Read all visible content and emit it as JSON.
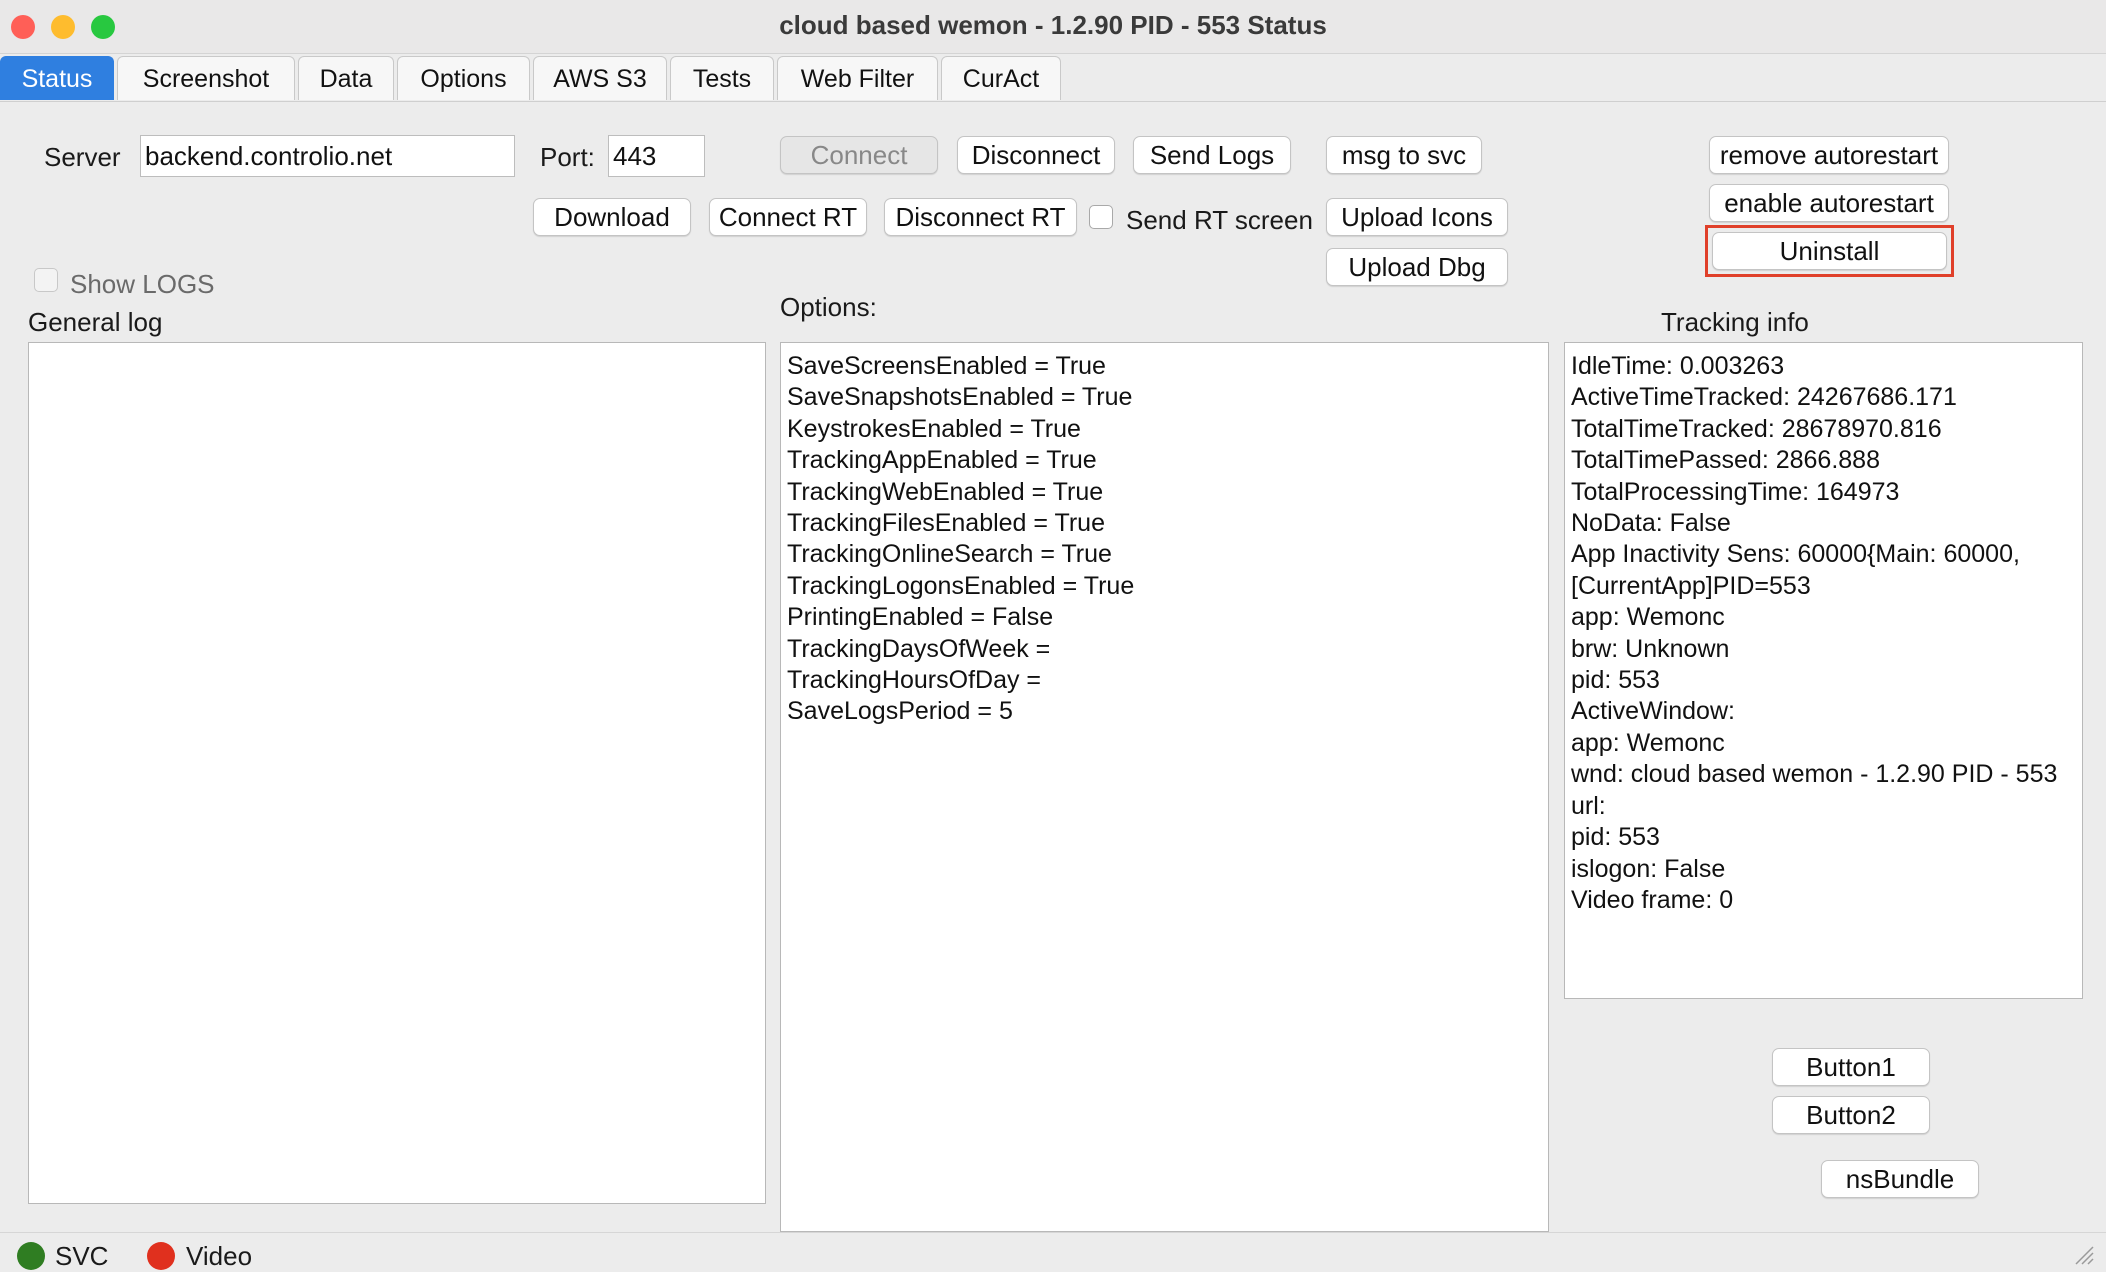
{
  "window": {
    "title": "cloud based wemon - 1.2.90 PID - 553 Status",
    "traffic_lights": [
      "#ff5f57",
      "#febc2e",
      "#28c840"
    ]
  },
  "tabs": [
    {
      "label": "Status",
      "active": true
    },
    {
      "label": "Screenshot"
    },
    {
      "label": "Data"
    },
    {
      "label": "Options"
    },
    {
      "label": "AWS S3"
    },
    {
      "label": "Tests"
    },
    {
      "label": "Web Filter"
    },
    {
      "label": "CurAct"
    }
  ],
  "connection": {
    "server_label": "Server",
    "server_value": "backend.controlio.net",
    "port_label": "Port:",
    "port_value": "443"
  },
  "buttons": {
    "connect": "Connect",
    "disconnect": "Disconnect",
    "send_logs": "Send Logs",
    "msg_to_svc": "msg to svc",
    "remove_autorestart": "remove autorestart",
    "enable_autorestart": "enable autorestart",
    "uninstall": "Uninstall",
    "download": "Download",
    "connect_rt": "Connect RT",
    "disconnect_rt": "Disconnect RT",
    "upload_icons": "Upload Icons",
    "upload_dbg": "Upload Dbg",
    "button1": "Button1",
    "button2": "Button2",
    "nsbundle": "nsBundle"
  },
  "checkboxes": {
    "send_rt_screen": {
      "label": "Send RT screen",
      "checked": false
    },
    "show_logs": {
      "label": "Show LOGS",
      "checked": false
    }
  },
  "general_log": {
    "title": "General log"
  },
  "options": {
    "title": "Options:",
    "lines": [
      "SaveScreensEnabled = True",
      "SaveSnapshotsEnabled = True",
      "KeystrokesEnabled = True",
      "TrackingAppEnabled = True",
      "TrackingWebEnabled = True",
      "TrackingFilesEnabled = True",
      "TrackingOnlineSearch = True",
      "TrackingLogonsEnabled = True",
      "PrintingEnabled = False",
      "TrackingDaysOfWeek =",
      "TrackingHoursOfDay =",
      "SaveLogsPeriod = 5"
    ]
  },
  "tracking_info": {
    "title": "Tracking info",
    "lines": [
      "IdleTime: 0.003263",
      "ActiveTimeTracked: 24267686.171",
      "TotalTimeTracked: 28678970.816",
      "TotalTimePassed: 2866.888",
      "TotalProcessingTime: 164973",
      "NoData: False",
      "App Inactivity Sens: 60000{Main: 60000,",
      "[CurrentApp]PID=553",
      "app: Wemonc",
      "brw: Unknown",
      "pid: 553",
      "ActiveWindow:",
      "app: Wemonc",
      "wnd: cloud based wemon - 1.2.90 PID - 553",
      "url:",
      "pid: 553",
      "islogon: False",
      "Video frame: 0"
    ]
  },
  "status_bar": {
    "svc_label": "SVC",
    "svc_color": "#2f7d22",
    "video_label": "Video",
    "video_color": "#e0301e"
  },
  "highlight_color": "#e0402a"
}
